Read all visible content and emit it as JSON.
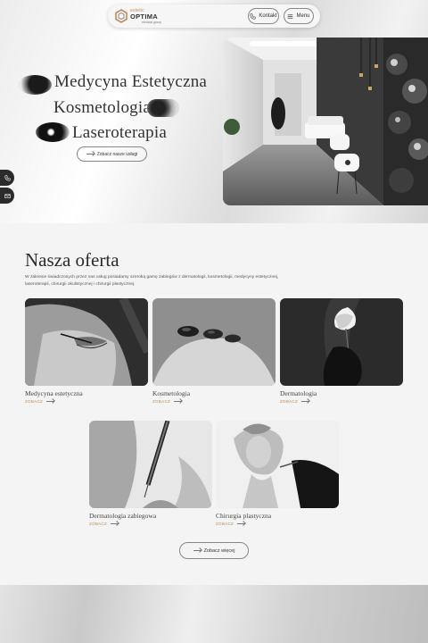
{
  "brand": {
    "line1": "estetic",
    "line2": "OPTIMA",
    "line3": "medical group",
    "accent": "#c08a5a"
  },
  "nav": {
    "contact_label": "Kontakt",
    "menu_label": "Menu",
    "contact_icon": "phone-icon",
    "menu_icon": "hamburger-icon"
  },
  "hero": {
    "lines": [
      "Medycyna Estetyczna",
      "Kosmetologia",
      "Laseroterapia"
    ],
    "button_label": "Zobacz nasze usługi"
  },
  "side_actions": [
    {
      "icon": "phone-icon"
    },
    {
      "icon": "mail-icon"
    }
  ],
  "offer": {
    "title": "Nasza oferta",
    "description": "W zakresie świadczonych przez nas usług posiadamy szeroką gamę zabiegów z dermatologii, kosmetologii, medycyny estetycznej, laseroterapii, chirurgii okulistycznej i chirurgii plastycznej.",
    "cards": [
      {
        "title": "Medycyna estetyczna",
        "link": "ZOBACZ"
      },
      {
        "title": "Kosmetologia",
        "link": "ZOBACZ"
      },
      {
        "title": "Dermatologia",
        "link": "ZOBACZ"
      },
      {
        "title": "Dermatologia zabiegowa",
        "link": "ZOBACZ"
      },
      {
        "title": "Chirurgia plastyczna",
        "link": "ZOBACZ"
      }
    ],
    "more_label": "Zobacz więcej"
  }
}
